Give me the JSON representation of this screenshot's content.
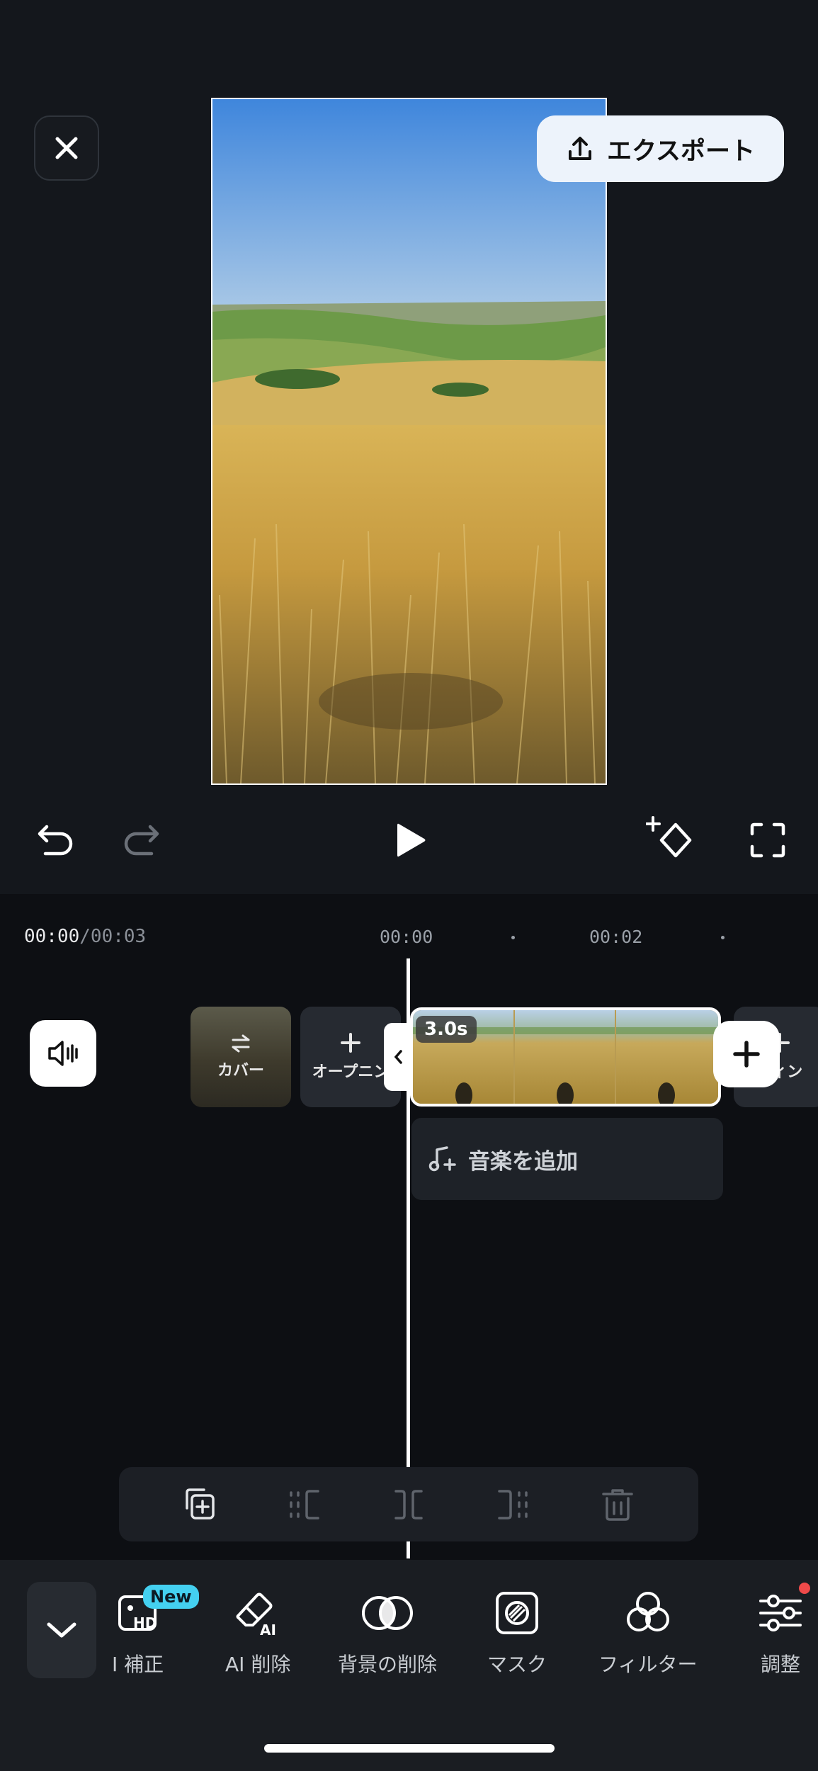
{
  "header": {
    "close_icon": "close-icon",
    "export_label": "エクスポート",
    "export_icon": "upload-icon"
  },
  "player": {
    "undo_icon": "undo-icon",
    "redo_icon": "redo-icon",
    "play_icon": "play-icon",
    "keyframe_icon": "keyframe-add-icon",
    "fullscreen_icon": "fullscreen-icon"
  },
  "timeline": {
    "current_time": "00:00",
    "total_time": "/00:03",
    "ruler": [
      "00:00",
      "00:02"
    ],
    "audio_icon": "speaker-icon",
    "cover_label": "カバー",
    "opening_label": "オープニン",
    "ending_label": "ディン",
    "clip_duration": "3.0s",
    "add_music_label": "音楽を追加"
  },
  "edit_tools": [
    "duplicate-icon",
    "split-left-icon",
    "split-icon",
    "split-right-icon",
    "delete-icon"
  ],
  "bottom_tools": [
    {
      "label": "I 補正",
      "icon": "hd-enhance-icon",
      "badge": "New"
    },
    {
      "label": "AI 削除",
      "icon": "ai-eraser-icon"
    },
    {
      "label": "背景の削除",
      "icon": "background-remove-icon"
    },
    {
      "label": "マスク",
      "icon": "mask-icon"
    },
    {
      "label": "フィルター",
      "icon": "filter-icon"
    },
    {
      "label": "調整",
      "icon": "adjust-icon"
    }
  ],
  "colors": {
    "background": "#14171c",
    "timeline_bg": "#0d0f13",
    "new_badge": "#44d0f0",
    "notify_dot": "#ef4a4a"
  }
}
